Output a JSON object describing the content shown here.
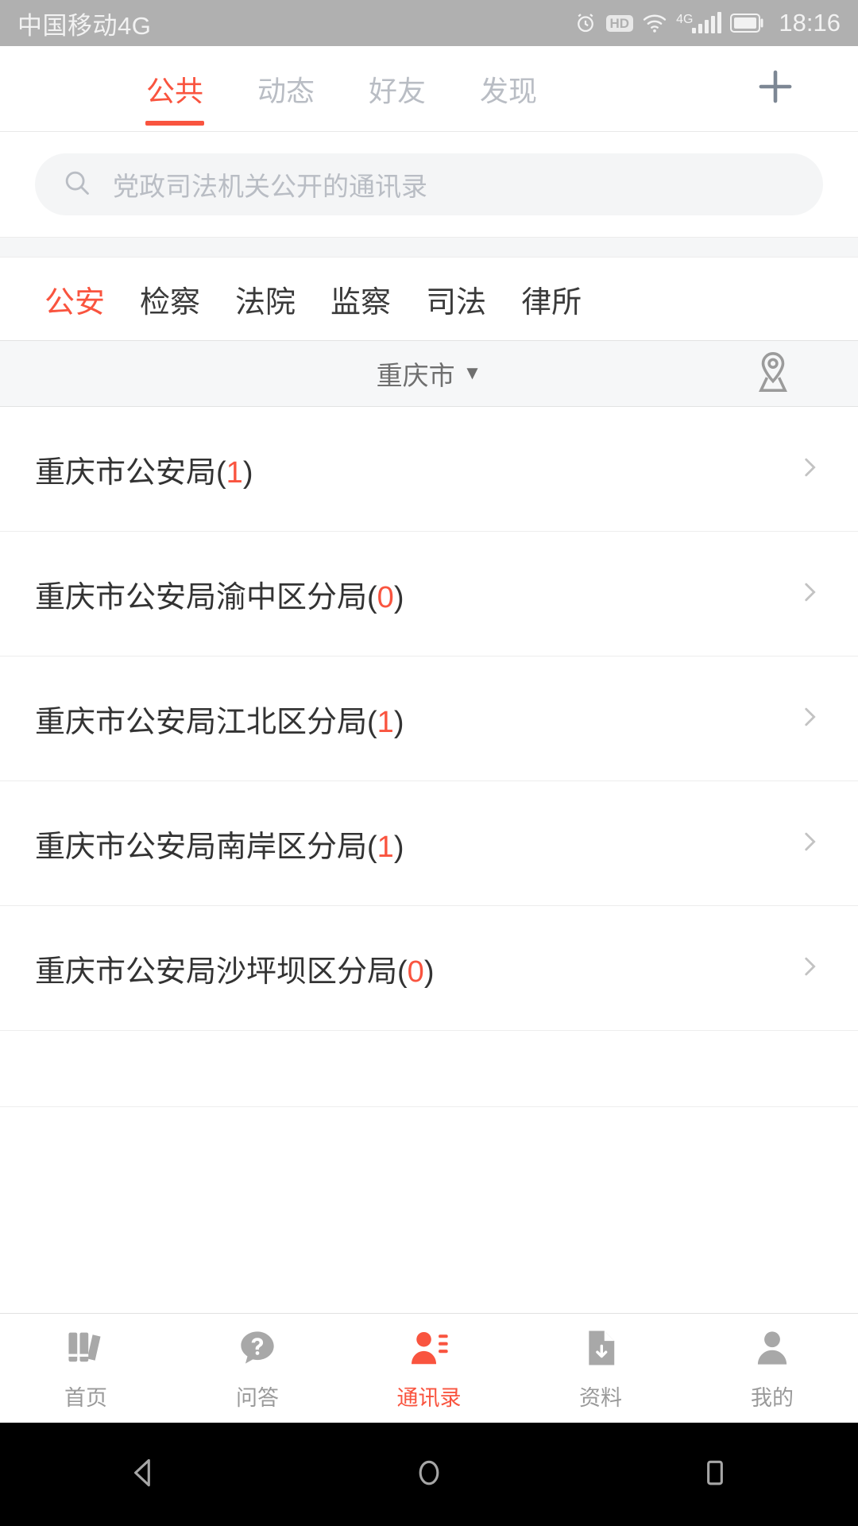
{
  "statusbar": {
    "carrier": "中国移动4G",
    "time": "18:16",
    "hd_label": "HD",
    "network_label": "4G",
    "icons": [
      "alarm-icon",
      "hd-icon",
      "wifi-icon",
      "signal-icon",
      "battery-icon"
    ]
  },
  "top_tabs": {
    "items": [
      {
        "label": "公共",
        "active": true
      },
      {
        "label": "动态",
        "active": false
      },
      {
        "label": "好友",
        "active": false
      },
      {
        "label": "发现",
        "active": false
      }
    ],
    "add_icon": "plus-icon"
  },
  "search": {
    "placeholder": "党政司法机关公开的通讯录",
    "value": "",
    "icon": "search-icon"
  },
  "categories": {
    "items": [
      {
        "label": "公安",
        "active": true
      },
      {
        "label": "检察",
        "active": false
      },
      {
        "label": "法院",
        "active": false
      },
      {
        "label": "监察",
        "active": false
      },
      {
        "label": "司法",
        "active": false
      },
      {
        "label": "律所",
        "active": false
      }
    ]
  },
  "city_bar": {
    "city": "重庆市",
    "caret": "▼",
    "location_icon": "location-pin-icon"
  },
  "list": {
    "items": [
      {
        "name": "重庆市公安局",
        "count": "1"
      },
      {
        "name": "重庆市公安局渝中区分局",
        "count": "0"
      },
      {
        "name": "重庆市公安局江北区分局",
        "count": "1"
      },
      {
        "name": "重庆市公安局南岸区分局",
        "count": "1"
      },
      {
        "name": "重庆市公安局沙坪坝区分局",
        "count": "0"
      }
    ]
  },
  "bottom_nav": {
    "items": [
      {
        "label": "首页",
        "icon": "books-icon",
        "active": false
      },
      {
        "label": "问答",
        "icon": "question-bubble-icon",
        "active": false
      },
      {
        "label": "通讯录",
        "icon": "contacts-icon",
        "active": true
      },
      {
        "label": "资料",
        "icon": "document-download-icon",
        "active": false
      },
      {
        "label": "我的",
        "icon": "person-icon",
        "active": false
      }
    ]
  },
  "android_nav": {
    "items": [
      {
        "icon": "back-triangle-icon"
      },
      {
        "icon": "home-circle-icon"
      },
      {
        "icon": "recents-square-icon"
      }
    ]
  },
  "colors": {
    "accent": "#f9543f",
    "statusbar_bg": "#b0b0b0",
    "muted_text": "#b9bdc4",
    "plus_icon": "#7d8794"
  }
}
